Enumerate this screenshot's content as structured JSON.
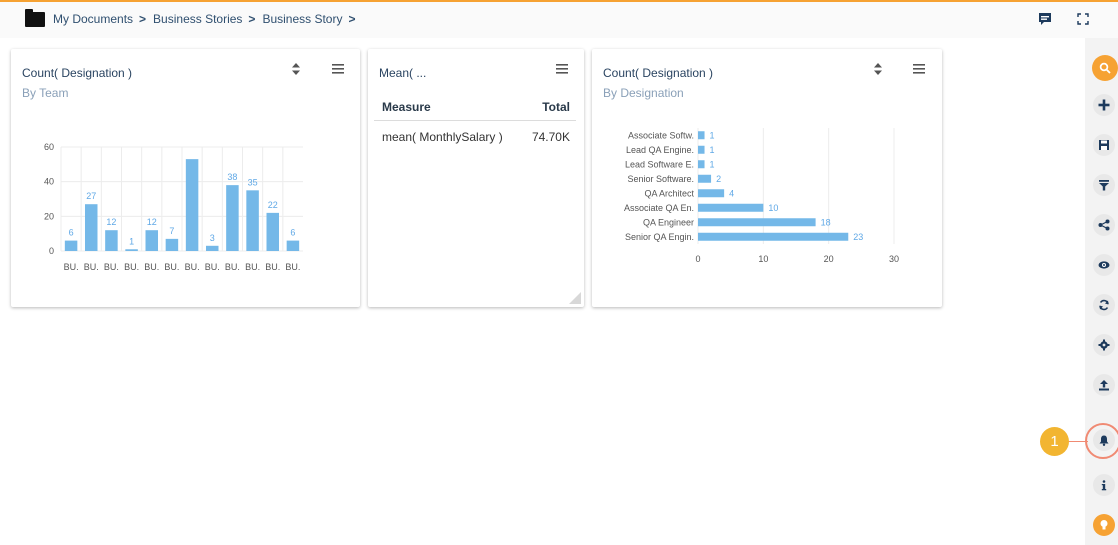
{
  "breadcrumb": {
    "items": [
      "My Documents",
      "Business Stories",
      "Business Story"
    ],
    "sep": ">"
  },
  "cards": {
    "team": {
      "title": "Count( Designation )",
      "subtitle": "By Team"
    },
    "mean": {
      "title": "Mean( ...",
      "headers": [
        "Measure",
        "Total"
      ],
      "row": {
        "measure": "mean( MonthlySalary )",
        "total": "74.70K"
      }
    },
    "designation": {
      "title": "Count( Designation )",
      "subtitle": "By Designation"
    }
  },
  "callout": {
    "number": "1"
  },
  "colors": {
    "bar": "#74b8e8",
    "accent": "#f6a233",
    "label": "#5fa8e6"
  },
  "icons": [
    "comment-icon",
    "fullscreen-icon",
    "search-icon",
    "plus-icon",
    "save-icon",
    "filter-icon",
    "share-icon",
    "eye-icon",
    "refresh-icon",
    "settings-icon",
    "export-icon",
    "bell-icon",
    "info-icon",
    "bulb-icon"
  ],
  "chart_data": [
    {
      "type": "bar",
      "categories": [
        "BU.",
        "BU.",
        "BU.",
        "BU.",
        "BU.",
        "BU.",
        "BU.",
        "BU.",
        "BU.",
        "BU.",
        "BU.",
        "BU."
      ],
      "values": [
        6,
        27,
        12,
        1,
        12,
        7,
        53,
        3,
        38,
        35,
        22,
        6
      ],
      "data_labels": [
        "6",
        "27",
        "12",
        "1",
        "12",
        "7",
        "",
        "3",
        "38",
        "35",
        "22",
        "6"
      ],
      "yticks": [
        "0",
        "20",
        "40",
        "60"
      ],
      "ylim": [
        0,
        60
      ],
      "grid": true,
      "legend": "none"
    },
    {
      "type": "bar",
      "orientation": "horizontal",
      "categories": [
        "Associate Softw.",
        "Lead QA Engine.",
        "Lead Software E.",
        "Senior Software.",
        "QA Architect",
        "Associate QA En.",
        "QA Engineer",
        "Senior QA Engin."
      ],
      "values": [
        1,
        1,
        1,
        2,
        4,
        10,
        18,
        23
      ],
      "xticks": [
        "0",
        "10",
        "20",
        "30"
      ],
      "xlim": [
        0,
        30
      ],
      "grid": true,
      "legend": "none"
    }
  ]
}
